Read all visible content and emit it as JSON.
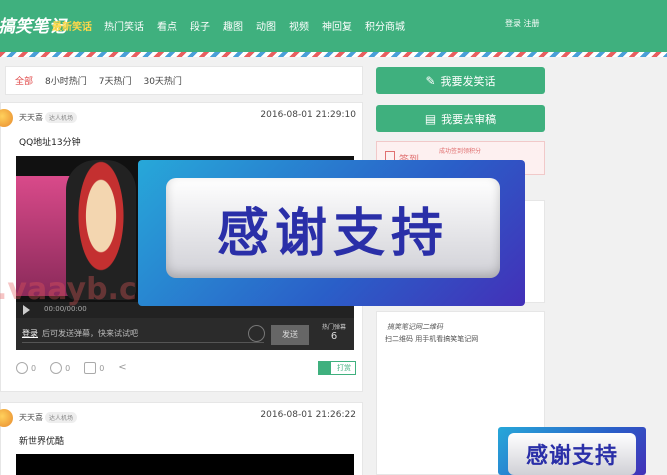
{
  "header": {
    "logo": "搞笑笔记",
    "logo_sub": "最新笑话",
    "nav": [
      "热门笑话",
      "看点",
      "段子",
      "趣图",
      "动图",
      "视频",
      "神回复",
      "积分商城"
    ],
    "login": "登录 注册"
  },
  "tabs": [
    "全部",
    "8小时热门",
    "7天热门",
    "30天热门"
  ],
  "posts": [
    {
      "user": "天天喜",
      "level": "达人机场",
      "time": "2016-08-01 21:29:10",
      "title": "QQ地址13分钟",
      "video_time": "00:00/00:00",
      "danmaku_label": "登录",
      "danmaku_placeholder": "后可发送弹幕，快来试试吧",
      "danmaku_send": "发送",
      "hot_label": "热门弹幕",
      "hot_count": "6",
      "likes": "0",
      "dislikes": "0",
      "comments": "0",
      "reward": "打赏"
    },
    {
      "user": "天天喜",
      "level": "达人机场",
      "time": "2016-08-01 21:26:22",
      "title": "新世界优酷"
    }
  ],
  "sidebar": {
    "post_joke": "我要发笑话",
    "review": "我要去审稿",
    "checkin": "签到",
    "checkin_tip": "成功签到领积分",
    "qr_title": "搞笑笔记网二维码",
    "qr_desc": "扫二维码 用手机看搞笑笔记网"
  },
  "overlay": {
    "thanks": "感谢支持",
    "watermark": ".vaayb.cn"
  }
}
